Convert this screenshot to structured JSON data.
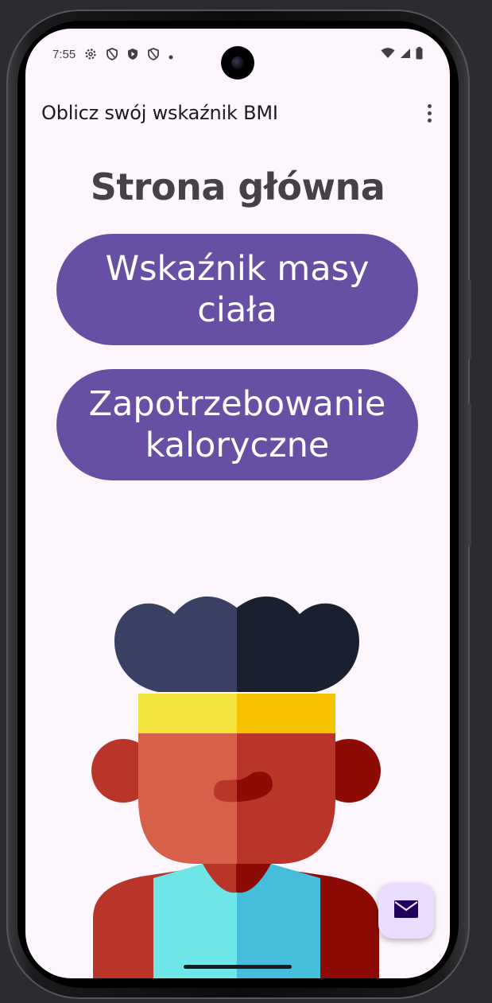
{
  "status_bar": {
    "time": "7:55",
    "left_icons": [
      "gear-icon",
      "shield-icon",
      "shield-filled-icon",
      "shield-icon",
      "dot-icon"
    ],
    "right_icons": [
      "wifi-icon",
      "signal-icon",
      "battery-icon"
    ]
  },
  "app_bar": {
    "title": "Oblicz swój wskaźnik BMI",
    "menu_icon": "more-vert-icon"
  },
  "main": {
    "heading": "Strona główna",
    "buttons": [
      {
        "label": "Wskaźnik masy ciała"
      },
      {
        "label": "Zapotrzebowanie kaloryczne"
      }
    ]
  },
  "fab": {
    "icon": "mail-icon"
  },
  "colors": {
    "background": "#fdf6fd",
    "primary": "#6750a4",
    "on_primary": "#ffffff",
    "fab_container": "#eaddff",
    "fab_icon": "#21005d",
    "heading": "#444148"
  }
}
